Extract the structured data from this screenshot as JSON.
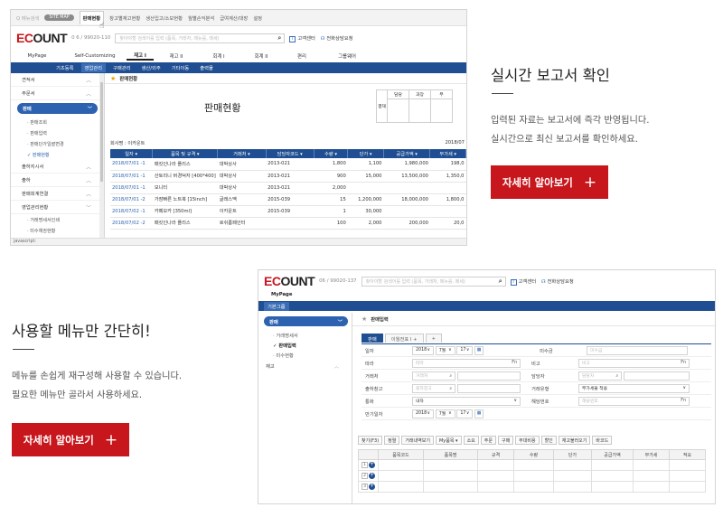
{
  "shot1": {
    "topbar": {
      "search": "Q 메뉴검색",
      "pill": "SITE MAP",
      "nav": [
        "판매현황",
        "창고별재고현황",
        "생산입고/소모현황",
        "월별손익분석",
        "급여계산/대장",
        "설정"
      ]
    },
    "header": {
      "logo_a": "EC",
      "logo_b": "OUNT",
      "account": "0 6 / 99020-110",
      "search_placeholder": "찾아야할 검색어를 입력 (품목, 거래처, 메뉴를, 메세)",
      "help": "고객센터",
      "chat": "전화상담요청"
    },
    "menu": [
      "MyPage",
      "Self-Customizing",
      "재고 I",
      "재고 II",
      "회계 I",
      "회계 II",
      "편리",
      "그룹웨어"
    ],
    "submenu": [
      "기초등록",
      "영업관리",
      "구매관리",
      "생산/외주",
      "기타이동",
      "출력물"
    ],
    "sidebar": {
      "items_top": [
        "견적서",
        "주문서"
      ],
      "selected": "판매",
      "subs": [
        "· 판매조회",
        "· 판매입력",
        "· 판매단가일괄변경",
        "✓ 판매현황"
      ],
      "items_bottom": [
        "출하지시서",
        "출하",
        "판매회계연결",
        "영업관리현황"
      ],
      "subs_bottom": [
        "· 거래명세서인쇄",
        "· 미수채권현황"
      ]
    },
    "crumb": "판매현황",
    "report_title": "판매현황",
    "approval": {
      "side": "결재",
      "cols": [
        "담당",
        "과장",
        "부"
      ]
    },
    "company": "회사명 : 이카운트",
    "date": "2018/07",
    "columns": [
      "일자 ▾",
      "품목 및 규격 ▾",
      "거래처 ▾",
      "담당자코드 ▾",
      "수량 ▾",
      "단가 ▾",
      "공급가액 ▾",
      "부가세 ▾"
    ],
    "rows": [
      [
        "2018/07/01 -1",
        "패킷인나라 플리스",
        "대박상사",
        "2013-021",
        "1,800",
        "1,100",
        "1,980,000",
        "198,0"
      ],
      [
        "2018/07/01 -1",
        "산토리니 버경덕자\n[400*400]",
        "대박상사",
        "2013-021",
        "900",
        "15,000",
        "13,500,000",
        "1,350,0"
      ],
      [
        "2018/07/01 -1",
        "모니터",
        "대박상사",
        "2013-021",
        "2,000",
        "",
        "",
        ""
      ],
      [
        "2018/07/01 -2",
        "가장빠른 노트북\n[15inch]",
        "글래스맥",
        "2015-039",
        "15",
        "1,200,000",
        "18,000,000",
        "1,800,0"
      ],
      [
        "2018/07/02 -1",
        "카페모카 [350ml]",
        "이카운트",
        "2015-039",
        "1",
        "30,000",
        "",
        ""
      ],
      [
        "2018/07/02 -2",
        "패킷인나라 플리스",
        "로쉬롬페인터",
        "",
        "100",
        "2,000",
        "200,000",
        "20,0"
      ]
    ],
    "status": "javascript:"
  },
  "promo1": {
    "title": "실시간 보고서 확인",
    "line1": "입력된 자료는 보고서에 즉각 반영됩니다.",
    "line2": "실시간으로 최신 보고서를 확인하세요.",
    "cta": "자세히 알아보기",
    "cta_icon": "+"
  },
  "promo2": {
    "title": "사용할 메뉴만 간단히!",
    "line1": "메뉴를 손쉽게 재구성해 사용할 수 있습니다.",
    "line2": "필요한 메뉴만 골라서 사용하세요.",
    "cta": "자세히 알아보기",
    "cta_icon": "+"
  },
  "shot2": {
    "header": {
      "logo_a": "EC",
      "logo_b": "OUNT",
      "account": "06 / 99020-137",
      "search_placeholder": "찾아야할 검색어를 입력 (품목, 거래처, 메뉴를, 메세)",
      "help": "고객센터",
      "chat": "전화상담요청"
    },
    "mypage": "MyPage",
    "submenu": "기본그룹",
    "sidebar": {
      "selected": "판매",
      "subs": [
        "· 거래명세서",
        "✓ 판매입력",
        "· 미수현황"
      ],
      "group": "재고"
    },
    "crumb": "판매입력",
    "tabs": [
      "판매",
      "이월전표 I +",
      "+"
    ],
    "form": {
      "date_label": "일자",
      "year": "2018",
      "month": "7월",
      "day": "17",
      "receivable_label": "미수금",
      "receivable_ph": "미수금",
      "ref_label": "따라",
      "ref_ph": "따라",
      "memo_label": "비고",
      "memo_ph": "비고",
      "client_label": "거래처",
      "client_ph": "거래처",
      "manager_label": "담당자",
      "manager_ph": "담당자",
      "warehouse_label": "출하창고",
      "warehouse_ph": "출하창고",
      "type_label": "거래유형",
      "type_value": "부가세율 적용",
      "currency_label": "통화",
      "currency_value": "내자",
      "proj_label": "해당번호",
      "proj_ph": "해당번호",
      "due_label": "만기일자",
      "due_year": "2018",
      "due_month": "7월",
      "due_day": "17",
      "fn": "Fn"
    },
    "toolbar": [
      "찾기(F3)",
      "정렬",
      "거래내역보기",
      "My품목 ▾",
      "소요",
      "주문",
      "구매",
      "부대비용",
      "할인",
      "재고불러오기",
      "바코드"
    ],
    "grid_cols": [
      "",
      "품목코드",
      "품목명",
      "규격",
      "수량",
      "단가",
      "공급가액",
      "부가세",
      "적요"
    ],
    "rows": [
      "1",
      "2",
      "3"
    ]
  }
}
